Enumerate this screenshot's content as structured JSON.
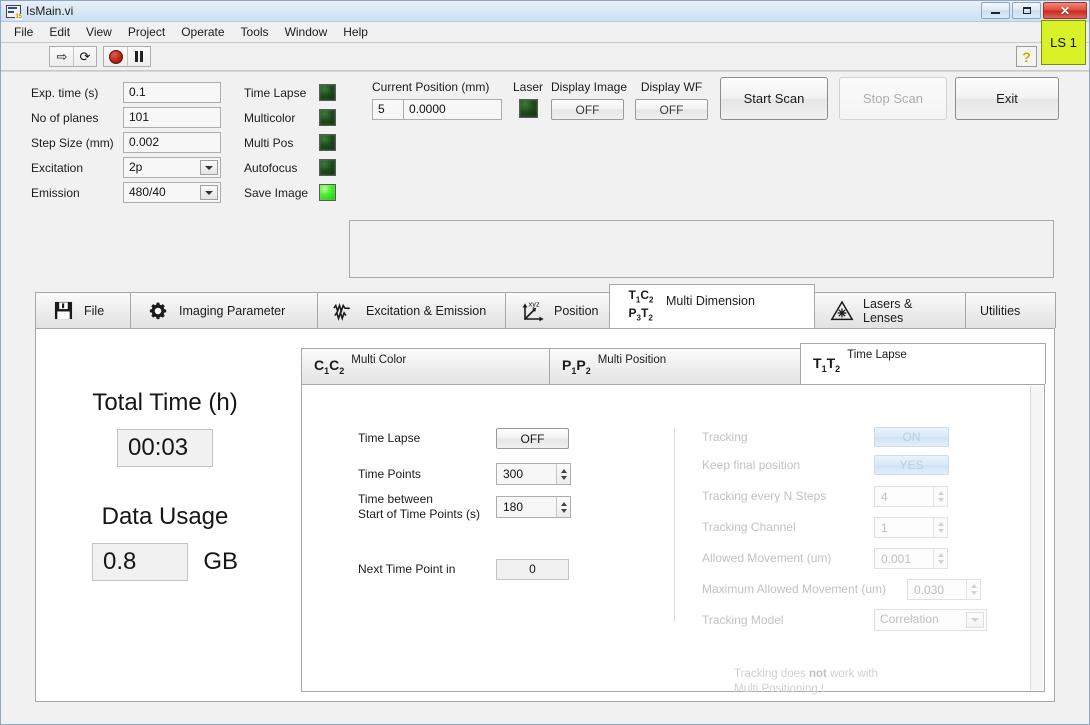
{
  "window": {
    "title": "IsMain.vi",
    "icon": "labview-vi-icon",
    "buttons": {
      "minimize": "minimize-icon",
      "maximize": "maximize-icon",
      "close": "✕"
    }
  },
  "menubar": {
    "items": [
      "File",
      "Edit",
      "View",
      "Project",
      "Operate",
      "Tools",
      "Window",
      "Help"
    ]
  },
  "toolbar": {
    "run_icon": "run-arrow-icon",
    "run_continuous_icon": "run-continuously-icon",
    "abort_icon": "abort-stop-icon",
    "pause_icon": "pause-icon",
    "help_icon": "context-help-icon",
    "ls_badge": "LS 1"
  },
  "settings": {
    "fields": [
      {
        "label": "Exp. time (s)",
        "value": "0.1",
        "type": "text"
      },
      {
        "label": "No of planes",
        "value": "101",
        "type": "text"
      },
      {
        "label": "Step Size (mm)",
        "value": "0.002",
        "type": "text"
      },
      {
        "label": "Excitation",
        "value": "2p",
        "type": "combo"
      },
      {
        "label": "Emission",
        "value": "480/40",
        "type": "combo"
      }
    ],
    "leds": [
      {
        "label": "Time Lapse",
        "state": "off"
      },
      {
        "label": "Multicolor",
        "state": "off"
      },
      {
        "label": "Multi Pos",
        "state": "off"
      },
      {
        "label": "Autofocus",
        "state": "off"
      },
      {
        "label": "Save Image",
        "state": "on"
      }
    ],
    "position": {
      "label": "Current Position (mm)",
      "index": "5",
      "value": "0.0000"
    },
    "laser": {
      "label": "Laser",
      "state": "off"
    },
    "display_image": {
      "label": "Display Image",
      "value": "OFF"
    },
    "display_wf": {
      "label": "Display WF",
      "value": "OFF"
    },
    "actions": [
      {
        "label": "Start Scan",
        "enabled": true
      },
      {
        "label": "Stop Scan",
        "enabled": false
      },
      {
        "label": "Exit",
        "enabled": true
      }
    ]
  },
  "main_tabs": [
    {
      "label": "File",
      "icon": "floppy-disk-icon",
      "active": false
    },
    {
      "label": "Imaging Parameter",
      "icon": "gear-icon",
      "active": false
    },
    {
      "label": "Excitation & Emission",
      "icon": "waveform-icon",
      "active": false
    },
    {
      "label": "Position",
      "icon": "xyz-axes-icon",
      "active": false
    },
    {
      "label": "Multi Dimension",
      "icon": "tcpt-subscript-icon",
      "active": true
    },
    {
      "label": "Lasers & Lenses",
      "icon": "laser-hazard-icon",
      "active": false
    },
    {
      "label": "Utilities",
      "icon": "none",
      "active": false
    }
  ],
  "sub_tabs": [
    {
      "label": "Multi Color",
      "icon_main": "C",
      "icon_sub1": "1",
      "icon_main2": "C",
      "icon_sub2": "2",
      "active": false
    },
    {
      "label": "Multi Position",
      "icon_main": "P",
      "icon_sub1": "1",
      "icon_main2": "P",
      "icon_sub2": "2",
      "active": false
    },
    {
      "label": "Time Lapse",
      "icon_main": "T",
      "icon_sub1": "1",
      "icon_main2": "T",
      "icon_sub2": "2",
      "active": true
    }
  ],
  "summary": {
    "total_time_label": "Total Time (h)",
    "total_time_value": "00:03",
    "data_usage_label": "Data Usage",
    "data_usage_value": "0.8",
    "data_usage_unit": "GB"
  },
  "timelapse": {
    "time_lapse_label": "Time Lapse",
    "time_lapse_value": "OFF",
    "time_points_label": "Time Points",
    "time_points_value": "300",
    "time_between_label_line1": "Time between",
    "time_between_label_line2": "Start of Time Points (s)",
    "time_between_value": "180",
    "next_time_point_label": "Next Time Point in",
    "next_time_point_value": "0"
  },
  "tracking": {
    "tracking_label": "Tracking",
    "tracking_value": "ON",
    "keep_final_label": "Keep final position",
    "keep_final_value": "YES",
    "every_n_label": "Tracking every N Steps",
    "every_n_value": "4",
    "channel_label": "Tracking Channel",
    "channel_value": "1",
    "allowed_label": "Allowed Movement (um)",
    "allowed_value": "0.001",
    "max_allowed_label": "Maximum Allowed Movement (um)",
    "max_allowed_value": "0.030",
    "model_label": "Tracking Model",
    "model_value": "Correlation",
    "note_line1_a": "Tracking does ",
    "note_line1_b": "not",
    "note_line1_c": " work with",
    "note_line2": "Multi Positioning !"
  },
  "colors": {
    "led_on": "#19c400",
    "led_off": "#1d4d1c",
    "badge": "#d9f227",
    "close_button": "#c42a1c",
    "panel_bg": "#f1f1f1"
  }
}
